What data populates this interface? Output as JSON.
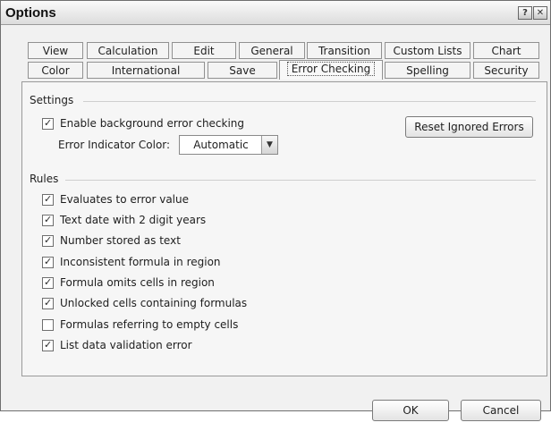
{
  "window": {
    "title": "Options",
    "help_icon_glyph": "?",
    "close_icon_glyph": "✕"
  },
  "tabs_row1": [
    "View",
    "Calculation",
    "Edit",
    "General",
    "Transition",
    "Custom Lists",
    "Chart"
  ],
  "tabs_row2": [
    "Color",
    "International",
    "Save",
    "Error Checking",
    "Spelling",
    "Security"
  ],
  "active_tab": "Error Checking",
  "settings": {
    "section_label": "Settings",
    "enable_background": {
      "label": "Enable background error checking",
      "checked": true
    },
    "indicator_label": "Error Indicator Color:",
    "indicator_value": "Automatic",
    "reset_button": "Reset Ignored Errors"
  },
  "rules": {
    "section_label": "Rules",
    "items": [
      {
        "label": "Evaluates to error value",
        "checked": true
      },
      {
        "label": "Text date with 2 digit years",
        "checked": true
      },
      {
        "label": "Number stored as text",
        "checked": true
      },
      {
        "label": "Inconsistent formula in region",
        "checked": true
      },
      {
        "label": "Formula omits cells in region",
        "checked": true
      },
      {
        "label": "Unlocked cells containing formulas",
        "checked": true
      },
      {
        "label": "Formulas referring to empty cells",
        "checked": false
      },
      {
        "label": "List data validation error",
        "checked": true
      }
    ]
  },
  "footer": {
    "ok": "OK",
    "cancel": "Cancel"
  }
}
